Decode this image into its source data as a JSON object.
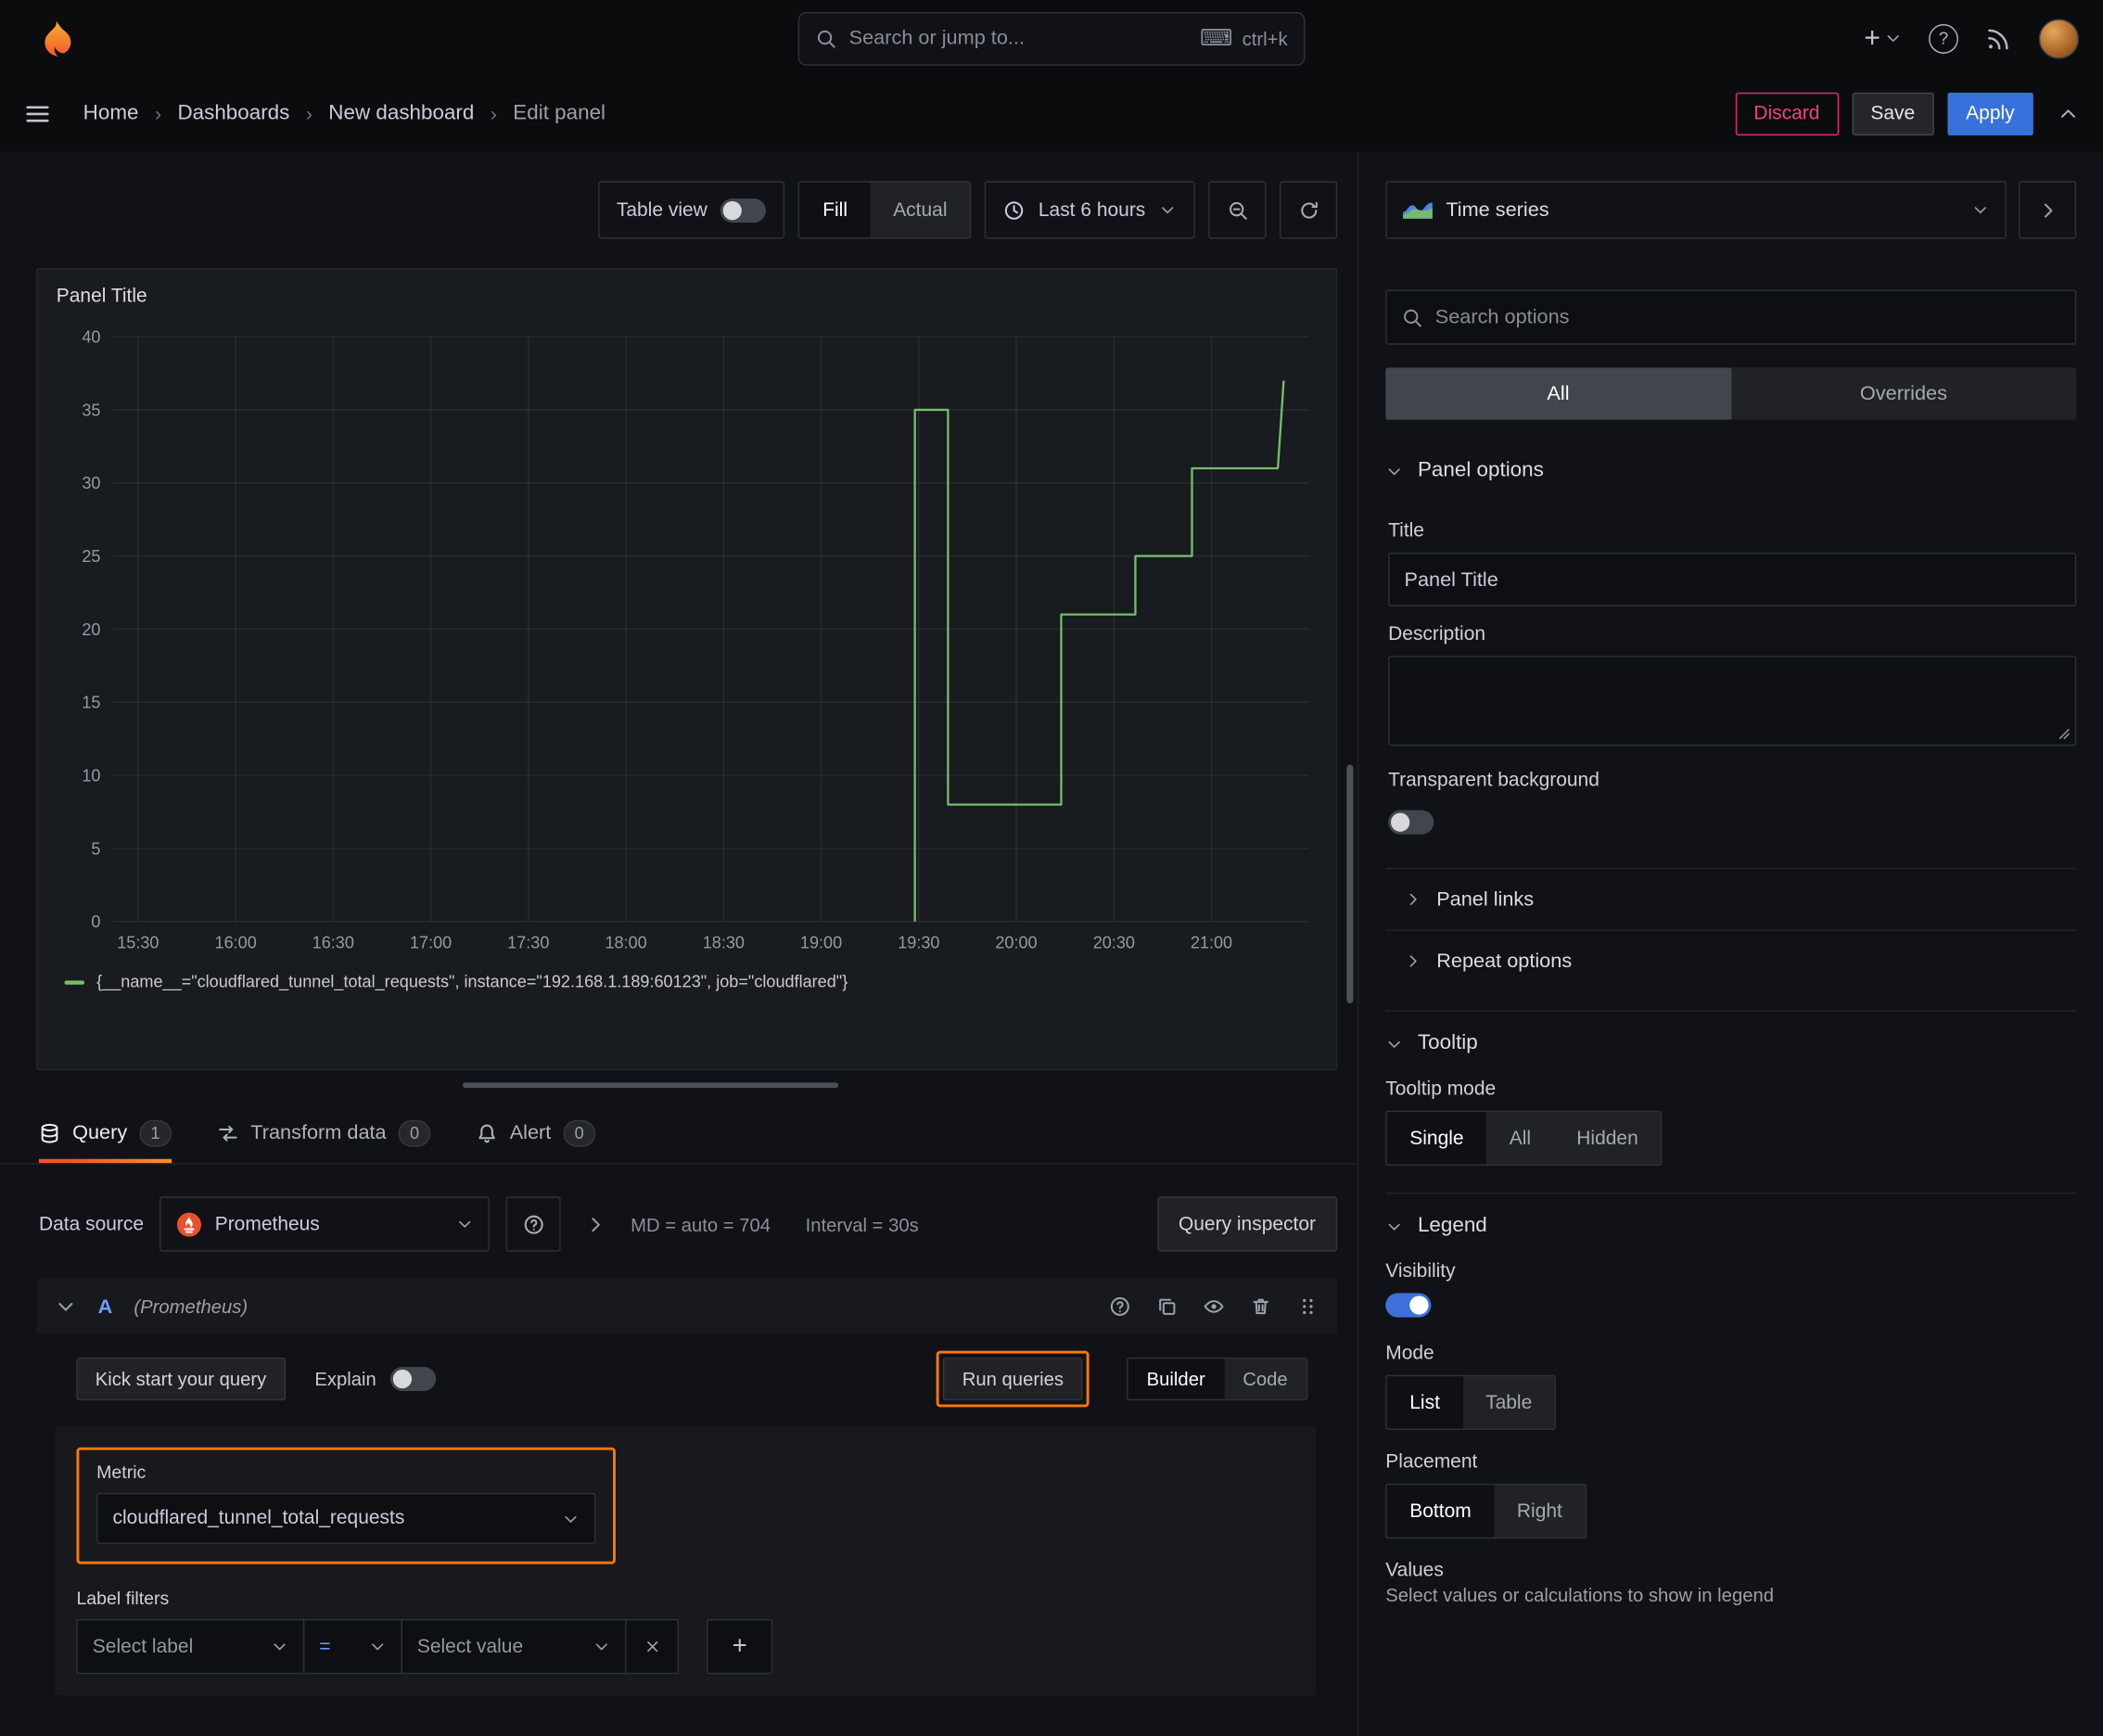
{
  "colors": {
    "accent_orange": "#ff780a",
    "series_green": "#73bf69",
    "primary_blue": "#3871dc",
    "danger_red": "#e02f6e"
  },
  "topbar": {
    "search_placeholder": "Search or jump to...",
    "search_shortcut": "ctrl+k"
  },
  "nav": {
    "breadcrumbs": [
      "Home",
      "Dashboards",
      "New dashboard",
      "Edit panel"
    ],
    "discard_label": "Discard",
    "save_label": "Save",
    "apply_label": "Apply"
  },
  "canvas_toolbar": {
    "table_view_label": "Table view",
    "display_modes": [
      "Fill",
      "Actual"
    ],
    "active_display_mode": "Fill",
    "time_range_label": "Last 6 hours"
  },
  "panel": {
    "title": "Panel Title"
  },
  "chart_data": {
    "type": "line",
    "title": "Panel Title",
    "x_ticks": [
      "15:30",
      "16:00",
      "16:30",
      "17:00",
      "17:30",
      "18:00",
      "18:30",
      "19:00",
      "19:30",
      "20:00",
      "20:30",
      "21:00"
    ],
    "x_tick_hours": [
      15.5,
      16,
      16.5,
      17,
      17.5,
      18,
      18.5,
      19,
      19.5,
      20,
      20.5,
      21
    ],
    "x_range_hours": [
      15.37,
      21.5
    ],
    "y_ticks": [
      0,
      5,
      10,
      15,
      20,
      25,
      30,
      35,
      40
    ],
    "ylim": [
      0,
      40
    ],
    "grid": true,
    "legend_position": "bottom",
    "series": [
      {
        "name": "{__name__=\"cloudflared_tunnel_total_requests\", instance=\"192.168.1.189:60123\", job=\"cloudflared\"}",
        "color": "#73bf69",
        "points_hours_value": [
          [
            19.48,
            0
          ],
          [
            19.48,
            35
          ],
          [
            19.65,
            35
          ],
          [
            19.65,
            8
          ],
          [
            20.23,
            8
          ],
          [
            20.23,
            21
          ],
          [
            20.61,
            21
          ],
          [
            20.61,
            25
          ],
          [
            20.9,
            25
          ],
          [
            20.9,
            31
          ],
          [
            21.34,
            31
          ],
          [
            21.37,
            37
          ]
        ]
      }
    ]
  },
  "editor_tabs": [
    {
      "label": "Query",
      "count": "1",
      "active": true
    },
    {
      "label": "Transform data",
      "count": "0",
      "active": false
    },
    {
      "label": "Alert",
      "count": "0",
      "active": false
    }
  ],
  "query": {
    "data_source_label": "Data source",
    "data_source_value": "Prometheus",
    "max_data_points": "MD = auto = 704",
    "interval": "Interval = 30s",
    "query_inspector_label": "Query inspector",
    "row": {
      "ref_id": "A",
      "datasource_hint": "(Prometheus)"
    },
    "kick_start_label": "Kick start your query",
    "explain_label": "Explain",
    "run_queries_label": "Run queries",
    "editor_modes": [
      "Builder",
      "Code"
    ],
    "active_editor_mode": "Builder",
    "metric_label": "Metric",
    "metric_value": "cloudflared_tunnel_total_requests",
    "label_filters_label": "Label filters",
    "select_label_placeholder": "Select label",
    "operator_value": "=",
    "select_value_placeholder": "Select value"
  },
  "options_pane": {
    "viz_type": "Time series",
    "search_placeholder": "Search options",
    "filter_tabs": [
      "All",
      "Overrides"
    ],
    "active_filter_tab": "All",
    "panel_options": {
      "header": "Panel options",
      "title_label": "Title",
      "title_value": "Panel Title",
      "description_label": "Description",
      "description_value": "",
      "transparent_label": "Transparent background"
    },
    "panel_links_header": "Panel links",
    "repeat_options_header": "Repeat options",
    "tooltip": {
      "header": "Tooltip",
      "mode_label": "Tooltip mode",
      "modes": [
        "Single",
        "All",
        "Hidden"
      ],
      "active_mode": "Single"
    },
    "legend": {
      "header": "Legend",
      "visibility_label": "Visibility",
      "mode_label": "Mode",
      "modes": [
        "List",
        "Table"
      ],
      "active_mode": "List",
      "placement_label": "Placement",
      "placements": [
        "Bottom",
        "Right"
      ],
      "active_placement": "Bottom",
      "values_label": "Values",
      "values_hint": "Select values or calculations to show in legend"
    }
  }
}
